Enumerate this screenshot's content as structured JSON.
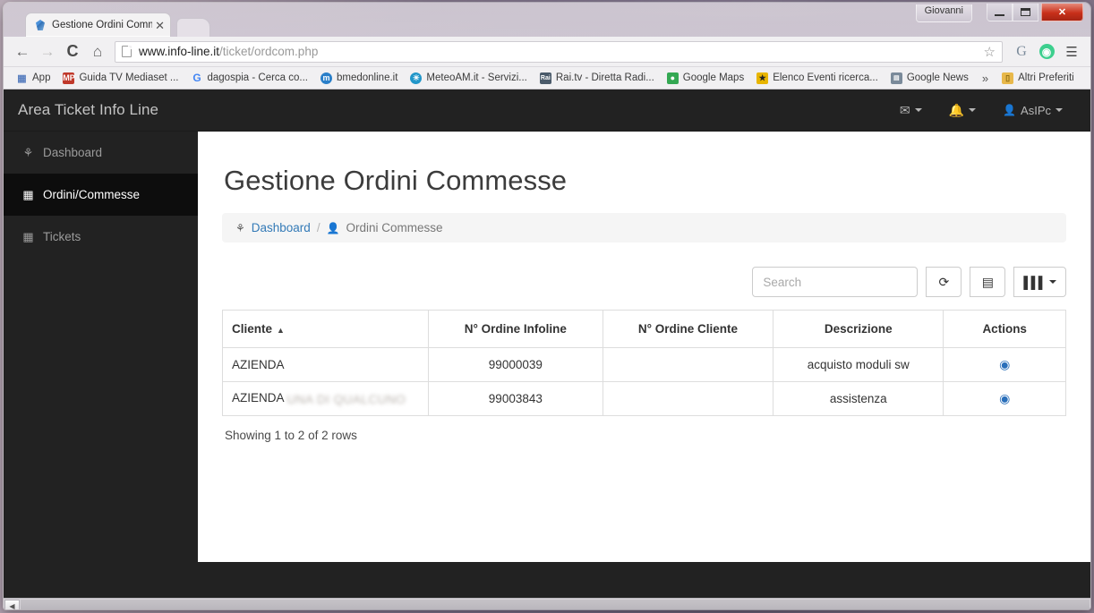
{
  "window": {
    "user_button": "Giovanni",
    "minimize": "—",
    "maximize": "□",
    "close": "✕"
  },
  "browser": {
    "tab": {
      "title": "Gestione Ordini Commes",
      "close": "✕"
    },
    "nav": {
      "back": "←",
      "forward": "→",
      "reload": "C",
      "home": "⌂",
      "star": "☆",
      "google": "G",
      "extension": "◔",
      "menu": "☰"
    },
    "url": {
      "domain": "www.info-line.it",
      "path": "/ticket/ordcom.php"
    },
    "bookmarks": [
      {
        "label": "App",
        "icon": "apps-grid-icon",
        "color": "#4a90d9"
      },
      {
        "label": "Guida TV Mediaset ...",
        "icon": "mediaset-icon",
        "color": "#c0392b"
      },
      {
        "label": "dagospia - Cerca co...",
        "icon": "google-icon",
        "color": "#4285f4"
      },
      {
        "label": "bmedonline.it",
        "icon": "m-circle-icon",
        "color": "#2a7fc9"
      },
      {
        "label": "MeteoAM.it - Servizi...",
        "icon": "globe-icon",
        "color": "#2196c9"
      },
      {
        "label": "Rai.tv - Diretta Radi...",
        "icon": "rai-icon",
        "color": "#4a5a6a"
      },
      {
        "label": "Google Maps",
        "icon": "maps-icon",
        "color": "#34a853"
      },
      {
        "label": "Elenco Eventi ricerca...",
        "icon": "events-icon",
        "color": "#e8b500"
      },
      {
        "label": "Google News",
        "icon": "news-icon",
        "color": "#7a8a9a"
      }
    ],
    "overflow": "»",
    "other_bookmarks": {
      "label": "Altri Preferiti",
      "icon": "folder-icon",
      "color": "#e8b84b"
    }
  },
  "app": {
    "brand": "Area Ticket Info Line",
    "header_right": [
      {
        "name": "messages-menu",
        "icon": "envelope-icon",
        "glyph": "✉",
        "label": ""
      },
      {
        "name": "notifications-menu",
        "icon": "bell-icon",
        "glyph": "ὑ4",
        "label": ""
      },
      {
        "name": "user-menu",
        "icon": "user-icon",
        "glyph": "♟",
        "label": "AsIPc"
      }
    ],
    "sidebar": [
      {
        "label": "Dashboard",
        "icon": "dashboard-icon",
        "glyph": "⛭",
        "active": false
      },
      {
        "label": "Ordini/Commesse",
        "icon": "table-icon",
        "glyph": "▦",
        "active": true
      },
      {
        "label": "Tickets",
        "icon": "table-icon",
        "glyph": "▦",
        "active": false
      }
    ]
  },
  "main": {
    "title": "Gestione Ordini Commesse",
    "breadcrumb": {
      "home_icon": "dashboard-icon",
      "home_label": "Dashboard",
      "separator": "/",
      "current_icon": "user-icon",
      "current_label": "Ordini Commesse"
    },
    "toolbar": {
      "search_placeholder": "Search",
      "search_value": "",
      "refresh_icon": "refresh-icon",
      "refresh_glyph": "⟳",
      "toggle_icon": "toggle-view-icon",
      "toggle_glyph": "▤",
      "columns_icon": "columns-icon",
      "columns_glyph": "▐▐▐"
    },
    "table": {
      "columns": [
        {
          "label": "Cliente",
          "align": "left",
          "sorted": true,
          "sort_caret": "▲"
        },
        {
          "label": "N° Ordine Infoline",
          "align": "center",
          "sorted": false
        },
        {
          "label": "N° Ordine Cliente",
          "align": "center",
          "sorted": false
        },
        {
          "label": "Descrizione",
          "align": "center",
          "sorted": false
        },
        {
          "label": "Actions",
          "align": "center",
          "sorted": false
        }
      ],
      "rows": [
        {
          "cliente": "AZIENDA",
          "cliente_redacted": "",
          "ordine_infoline": "99000039",
          "ordine_cliente": "",
          "descrizione": "acquisto moduli sw",
          "action_icon": "eye-icon",
          "action_glyph": "◉"
        },
        {
          "cliente": "AZIENDA",
          "cliente_redacted": "UNA DI QUALCUNO",
          "ordine_infoline": "99003843",
          "ordine_cliente": "",
          "descrizione": "assistenza",
          "action_icon": "eye-icon",
          "action_glyph": "◉"
        }
      ],
      "footer": "Showing 1 to 2 of 2 rows"
    }
  },
  "scrollbar": {
    "left_arrow": "◀"
  },
  "colors": {
    "sidebar_bg": "#222222",
    "sidebar_active": "#0d0d0d",
    "link": "#337ab7",
    "eye_icon": "#2a6fba",
    "close_button": "#c8301a"
  }
}
